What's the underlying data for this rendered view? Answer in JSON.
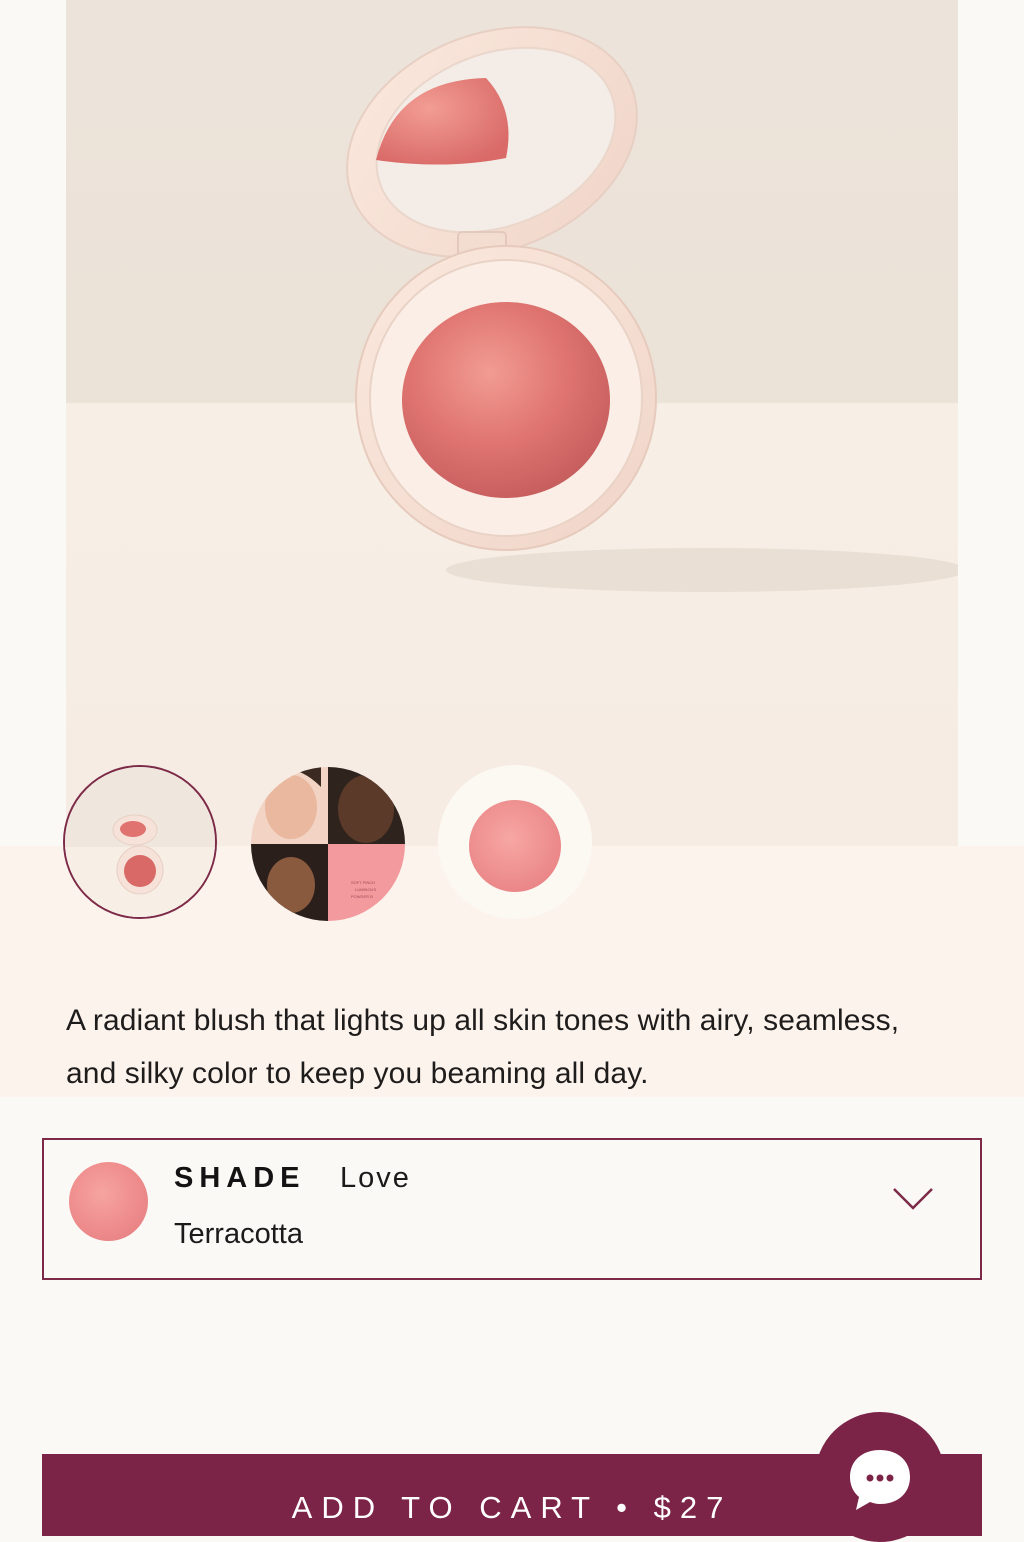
{
  "gallery": {
    "main_image_alt": "Blush compact, open",
    "thumbnails": [
      {
        "name": "compact",
        "selected": true
      },
      {
        "name": "models-collage",
        "selected": false
      },
      {
        "name": "swatch",
        "selected": false
      }
    ]
  },
  "product": {
    "description": "A radiant blush that lights up all skin tones with airy, seamless, and silky color to keep you beaming all day."
  },
  "shade": {
    "label": "SHADE",
    "value": "Love",
    "subtitle": "Terracotta",
    "swatch_color": "#ee8c8c"
  },
  "cart": {
    "label": "ADD TO CART • $27"
  },
  "chat": {
    "icon": "chat-bubble-icon"
  },
  "colors": {
    "accent": "#7c2448",
    "page_background": "#fbf9f5",
    "band_background": "#fcf3ed"
  }
}
